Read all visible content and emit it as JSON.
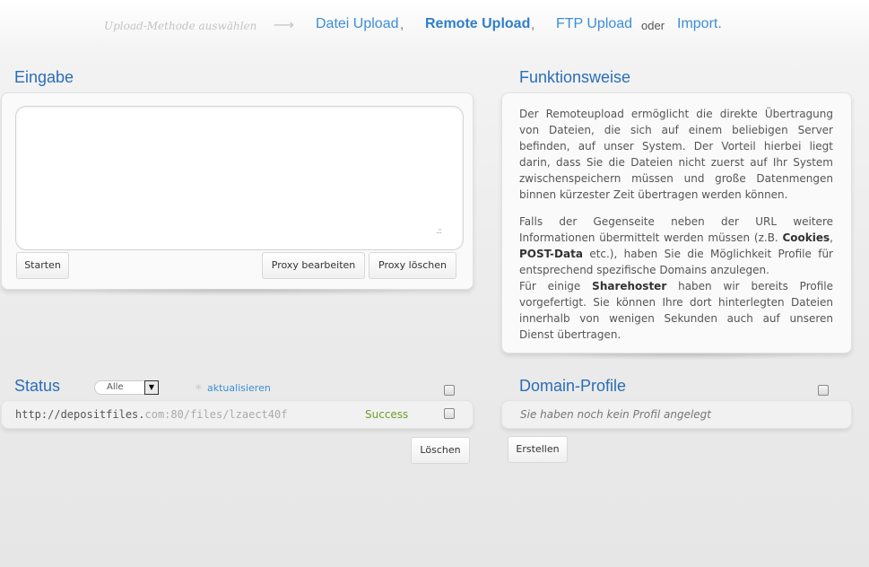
{
  "nav": {
    "hint": "Upload-Methode auswählen",
    "arrow": "⟶",
    "items": [
      "Datei Upload",
      "Remote Upload",
      "FTP Upload"
    ],
    "sep": ",",
    "or": "oder",
    "last": "Import."
  },
  "input_panel": {
    "title": "Eingabe",
    "textarea_value": "",
    "start_label": "Starten",
    "proxy_edit_label": "Proxy bearbeiten",
    "proxy_delete_label": "Proxy löschen"
  },
  "info_panel": {
    "title": "Funktionsweise",
    "p1": "Der Remoteupload ermöglicht die direkte Übertragung von Dateien, die sich auf einem beliebigen Server befinden, auf unser System. Der Vorteil hierbei liegt darin, dass Sie die Dateien nicht zuerst auf Ihr System zwischenspeichern müssen und große Datenmengen binnen kürzester Zeit übertragen werden können.",
    "p2_a": "Falls der Gegenseite neben der URL weitere Informationen übermittelt werden müssen (z.B. ",
    "p2_b1": "Cookies",
    "p2_c": ", ",
    "p2_b2": "POST-Data",
    "p2_d": " etc.), haben Sie die Möglichkeit Profile für entsprechend spezifische Domains anzulegen.",
    "p3_a": "Für einige ",
    "p3_b": "Sharehoster",
    "p3_c": " haben wir bereits Profile vorgefertigt. Sie können Ihre dort hinterlegten Dateien innerhalb von wenigen Sekunden auch auf unseren Dienst übertragen."
  },
  "status_panel": {
    "title": "Status",
    "filter_value": "Alle",
    "refresh_label": "aktualisieren",
    "rows": [
      {
        "url_main": "http://depositfiles.",
        "url_rest": "com:80/files/lzaect40f",
        "status": "Success"
      }
    ],
    "delete_label": "Löschen"
  },
  "domain_panel": {
    "title": "Domain-Profile",
    "empty_text": "Sie haben noch kein Profil angelegt",
    "create_label": "Erstellen"
  }
}
